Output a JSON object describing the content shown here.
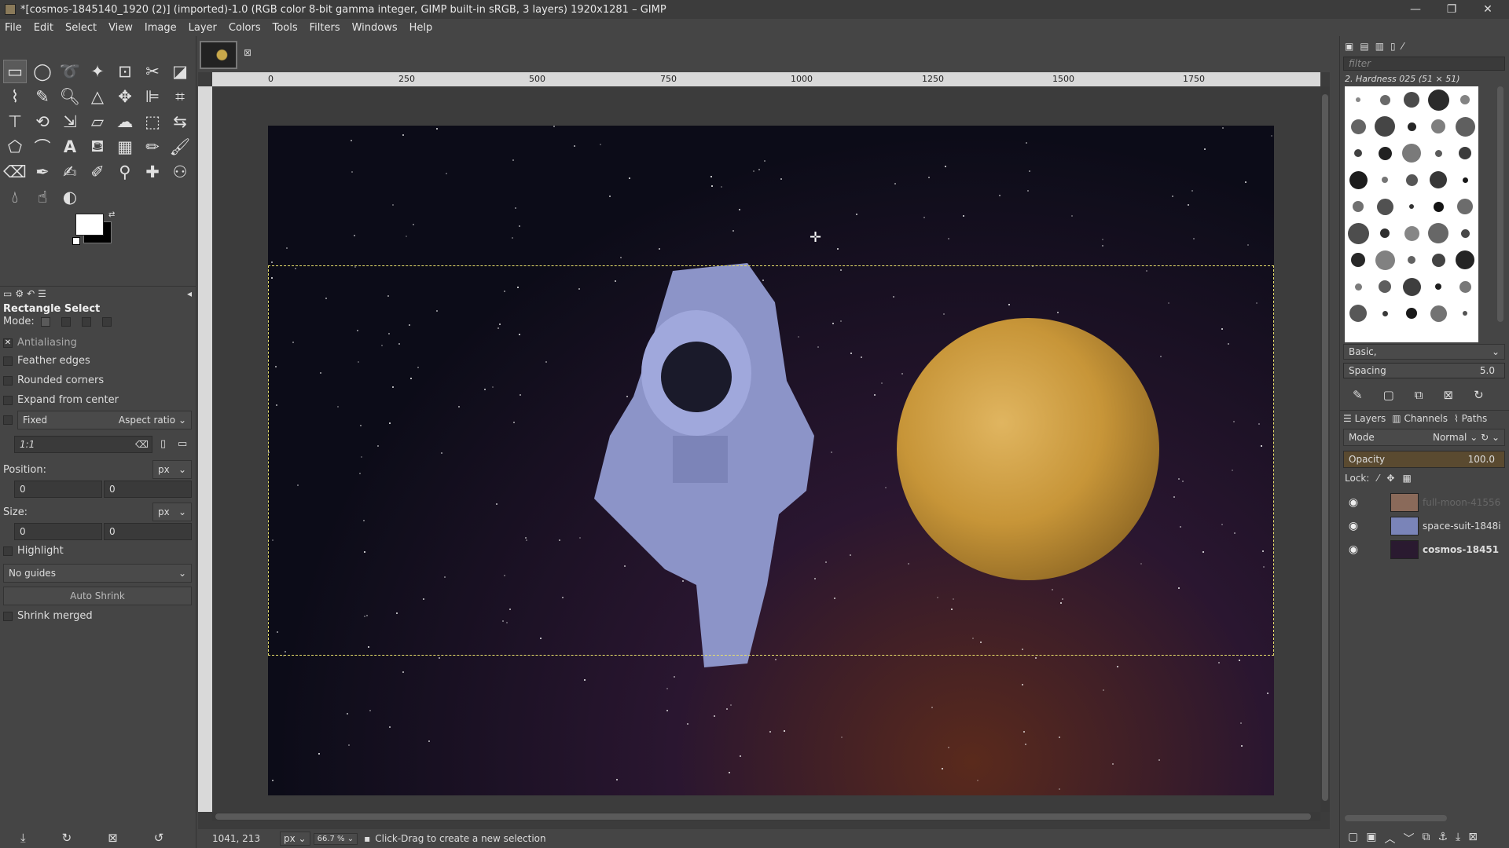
{
  "window": {
    "title": "*[cosmos-1845140_1920 (2)] (imported)-1.0 (RGB color 8-bit gamma integer, GIMP built-in sRGB, 3 layers) 1920x1281 – GIMP",
    "minimize": "—",
    "maximize": "❐",
    "close": "✕"
  },
  "menu": [
    "File",
    "Edit",
    "Select",
    "View",
    "Image",
    "Layer",
    "Colors",
    "Tools",
    "Filters",
    "Windows",
    "Help"
  ],
  "toolbox": {
    "tool_options_title": "Rectangle Select",
    "mode_label": "Mode:",
    "antialiasing": "Antialiasing",
    "feather": "Feather edges",
    "rounded": "Rounded corners",
    "expand": "Expand from center",
    "fixed": "Fixed",
    "aspect_ratio": "Aspect ratio",
    "ratio_value": "1:1",
    "position_label": "Position:",
    "position_unit": "px",
    "pos_x": "0",
    "pos_y": "0",
    "size_label": "Size:",
    "size_unit": "px",
    "size_w": "0",
    "size_h": "0",
    "highlight": "Highlight",
    "guides": "No guides",
    "auto_shrink": "Auto Shrink",
    "shrink_merged": "Shrink merged"
  },
  "ruler_labels": [
    "0",
    "250",
    "500",
    "750",
    "1000",
    "1250",
    "1500",
    "1750"
  ],
  "status": {
    "coords": "1041, 213",
    "unit": "px",
    "zoom": "66.7 %",
    "message": "Click-Drag to create a new selection"
  },
  "brushes": {
    "filter_placeholder": "filter",
    "current": "2. Hardness 025 (51 × 51)",
    "preset": "Basic,",
    "spacing_label": "Spacing",
    "spacing_value": "5.0"
  },
  "layers_panel": {
    "tab_layers": "Layers",
    "tab_channels": "Channels",
    "tab_paths": "Paths",
    "mode_label": "Mode",
    "mode_value": "Normal",
    "opacity_label": "Opacity",
    "opacity_value": "100.0",
    "lock_label": "Lock:",
    "layers": [
      {
        "name": "full-moon-41556"
      },
      {
        "name": "space-suit-1848i"
      },
      {
        "name": "cosmos-18451"
      }
    ]
  }
}
